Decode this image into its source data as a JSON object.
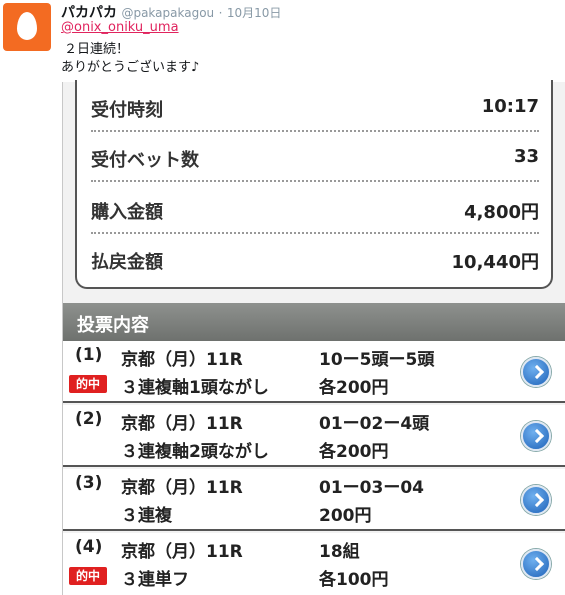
{
  "tweet": {
    "name": "パカパカ",
    "handle": "@pakapakagou",
    "dot": "·",
    "date": "10月10日",
    "mention": "@onix_oniku_uma",
    "line1": "２日連続！",
    "line2": "ありがとうございます♪",
    "avatar_color": "#f36b22"
  },
  "summary": {
    "rows": [
      {
        "label": "受付時刻",
        "value": "10:17"
      },
      {
        "label": "受付ベット数",
        "value": "33"
      },
      {
        "label": "購入金額",
        "value": "4,800円"
      },
      {
        "label": "払戻金額",
        "value": "10,440円"
      }
    ]
  },
  "section_title": "投票内容",
  "hit_label": "的中",
  "hit_color": "#e02020",
  "bets": [
    {
      "num": "(1)",
      "venue": "京都（月）11R",
      "selection": "10ー5頭ー5頭",
      "type": "３連複軸1頭ながし",
      "amount": "各200円",
      "hit": true
    },
    {
      "num": "(2)",
      "venue": "京都（月）11R",
      "selection": "01ー02ー4頭",
      "type": "３連複軸2頭ながし",
      "amount": "各200円",
      "hit": false
    },
    {
      "num": "(3)",
      "venue": "京都（月）11R",
      "selection": "01ー03ー04",
      "type": "３連複",
      "amount": "200円",
      "hit": false
    },
    {
      "num": "(4)",
      "venue": "京都（月）11R",
      "selection": "18組",
      "type": "３連単フ",
      "amount": "各100円",
      "hit": true
    }
  ]
}
